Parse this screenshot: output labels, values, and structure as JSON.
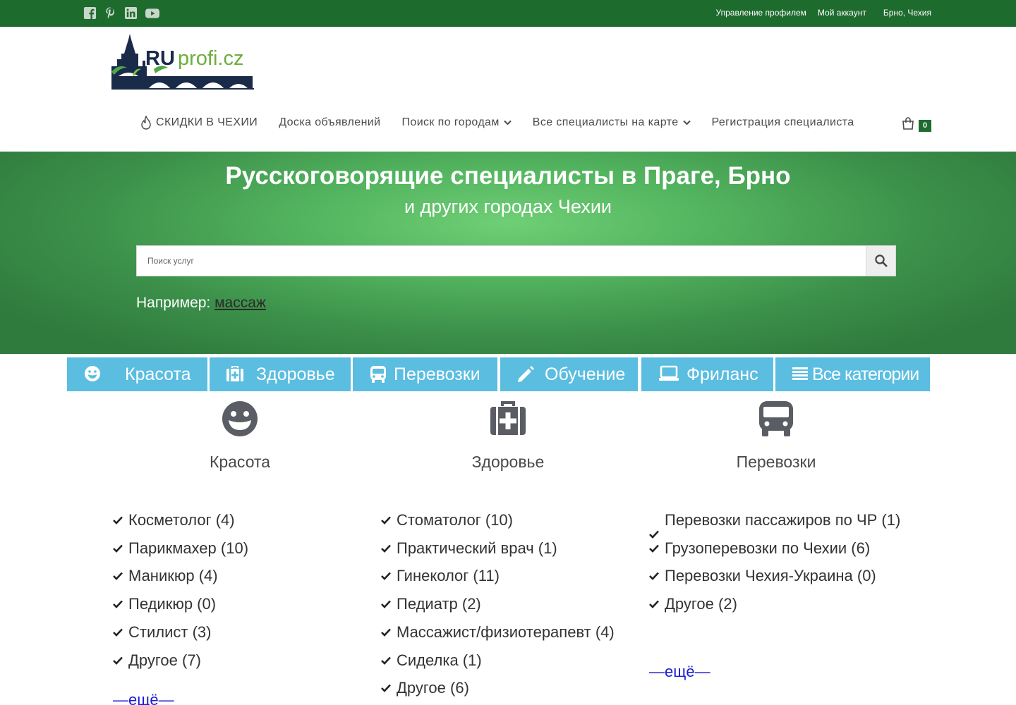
{
  "topbar": {
    "social": [
      "facebook-icon",
      "pinterest-icon",
      "linkedin-icon",
      "youtube-icon"
    ],
    "links": [
      "Управление профилем",
      "Мой аккаунт"
    ],
    "city": "Брно, Чехия"
  },
  "logo": {
    "text_ru": "RU",
    "text_rest": "profi.cz"
  },
  "nav": {
    "items": [
      {
        "label": "СКИДКИ В ЧЕХИИ"
      },
      {
        "label": "Доска объявлений"
      },
      {
        "label": "Поиск по городам"
      },
      {
        "label": "Все специалисты на карте"
      },
      {
        "label": "Регистрация специалиста"
      }
    ],
    "cart_count": "0"
  },
  "hero": {
    "title": "Русскоговорящие специалисты в Праге, Брно",
    "subtitle": "и других городах Чехии",
    "search_placeholder": "Поиск услуг",
    "example_prefix": "Например:",
    "example_link": "массаж"
  },
  "tabs": [
    {
      "label": "Красота",
      "icon": "grin-icon"
    },
    {
      "label": "Здоровье",
      "icon": "medkit-icon"
    },
    {
      "label": "Перевозки",
      "icon": "bus-icon"
    },
    {
      "label": "Обучение",
      "icon": "pencil-icon"
    },
    {
      "label": "Фриланс",
      "icon": "laptop-icon"
    },
    {
      "label": "Все категории",
      "icon": "list-icon"
    }
  ],
  "columns": [
    {
      "title": "Красота",
      "icon": "grin-icon",
      "items": [
        "Косметолог (4)",
        "Парикмахер (10)",
        "Маникюр (4)",
        "Педикюр (0)",
        "Стилист (3)",
        "Другое (7)"
      ],
      "more": "—ещё—"
    },
    {
      "title": "Здоровье",
      "icon": "medkit-icon",
      "items": [
        "Стоматолог (10)",
        "Практический врач (1)",
        "Гинеколог (11)",
        "Педиатр (2)",
        "Массажист/физиотерапевт (4)",
        "Сиделка (1)",
        "Другое (6)"
      ]
    },
    {
      "title": "Перевозки",
      "icon": "bus-icon",
      "items": [
        "Перевозки пассажиров по ЧР (1)",
        "Грузоперевозки по Чехии (6)",
        "Перевозки Чехия-Украина (0)",
        "Другое (2)"
      ],
      "more": "—ещё—"
    }
  ],
  "colors": {
    "topbar": "#1e6b2e",
    "tab": "#5bbde0",
    "hero": "#52b35e",
    "more_link": "#1a1ad6"
  }
}
